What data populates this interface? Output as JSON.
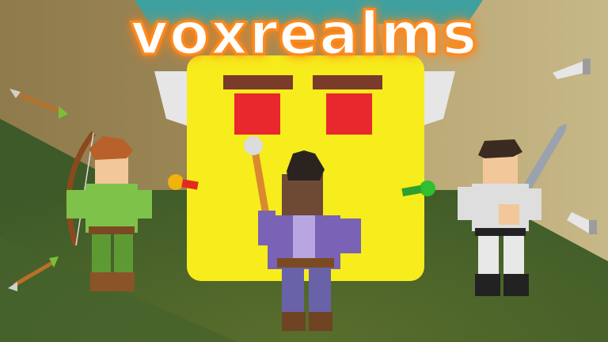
{
  "game": {
    "title": "voxrealms"
  },
  "colors": {
    "title_fill": "#ffffff",
    "title_glow": "#ff8a1c",
    "boss_face": "#f7ec1c",
    "boss_eyes": "#e8282c",
    "ground_grass": "#4f6a2a",
    "sky_wall": "#a8925c"
  },
  "icons": {
    "arrow_projectile": "arrow-icon",
    "spell_orb": "orb-icon",
    "blade_shard": "blade-icon"
  }
}
